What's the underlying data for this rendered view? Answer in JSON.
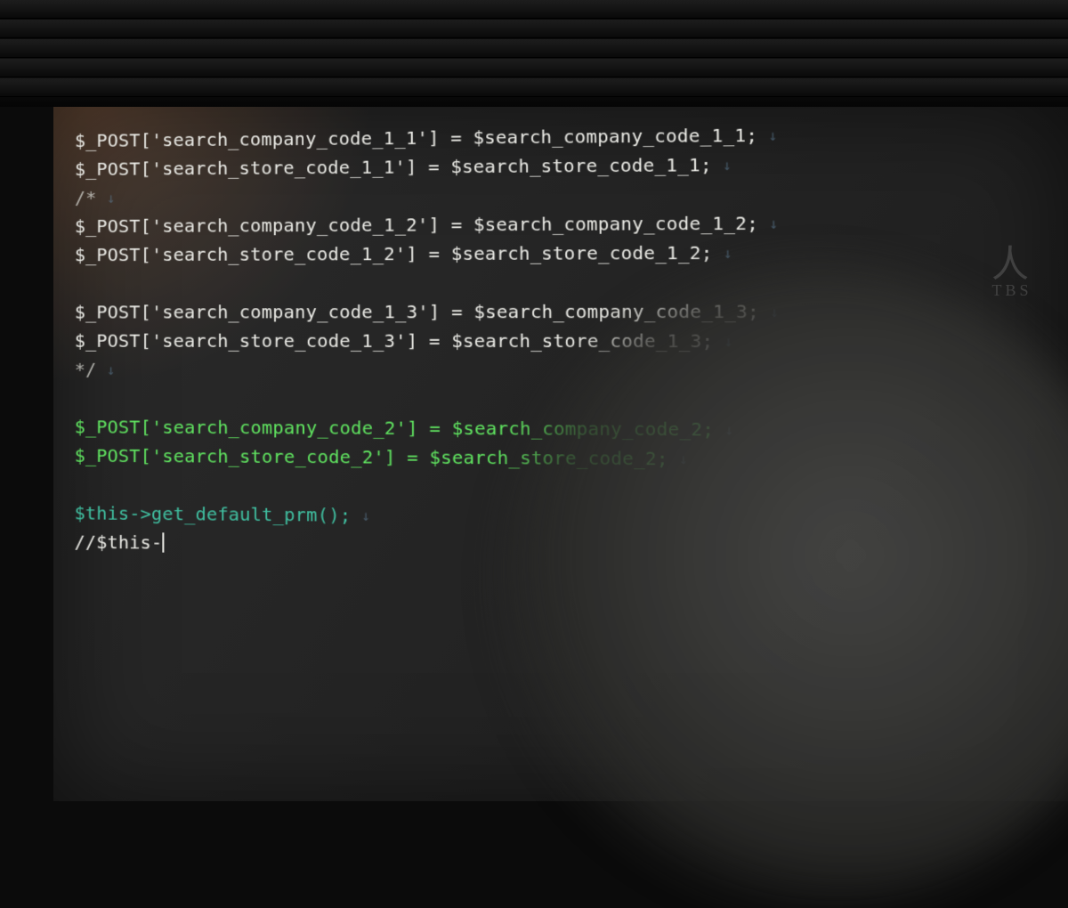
{
  "colors": {
    "default": "#e9e9e4",
    "highlight_green": "#5fe35f",
    "method_teal": "#3fbfa0",
    "eol_marker": "#5e7f9a"
  },
  "eol_glyph": "↓",
  "watermark": {
    "text": "TBS"
  },
  "code_lines": [
    {
      "color": "white",
      "text": "$_POST['search_company_code_1_1'] = $search_company_code_1_1;",
      "eol": true
    },
    {
      "color": "white",
      "text": "$_POST['search_store_code_1_1'] = $search_store_code_1_1;",
      "eol": true
    },
    {
      "color": "comment",
      "text": "/*",
      "eol": true
    },
    {
      "color": "white",
      "text": "$_POST['search_company_code_1_2'] = $search_company_code_1_2;",
      "eol": true
    },
    {
      "color": "white",
      "text": "$_POST['search_store_code_1_2'] = $search_store_code_1_2;",
      "eol": true
    },
    {
      "color": "white",
      "text": "",
      "eol": false
    },
    {
      "color": "white",
      "text": "$_POST['search_company_code_1_3'] = $search_company_code_1_3;",
      "eol": true
    },
    {
      "color": "white",
      "text": "$_POST['search_store_code_1_3'] = $search_store_code_1_3;",
      "eol": true
    },
    {
      "color": "comment",
      "text": "*/",
      "eol": true
    },
    {
      "color": "white",
      "text": "",
      "eol": false
    },
    {
      "color": "green",
      "text": "$_POST['search_company_code_2'] = $search_company_code_2;",
      "eol": true
    },
    {
      "color": "green",
      "text": "$_POST['search_store_code_2'] = $search_store_code_2;",
      "eol": true
    },
    {
      "color": "white",
      "text": "",
      "eol": false
    },
    {
      "color": "teal",
      "text": "$this->get_default_prm();",
      "eol": true
    },
    {
      "color": "white",
      "text": "//$this-",
      "eol": false,
      "cursor": true
    }
  ]
}
